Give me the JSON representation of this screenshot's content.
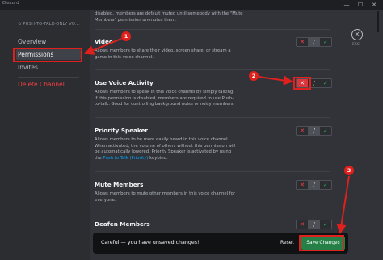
{
  "window": {
    "app_name": "Discord",
    "minimize_glyph": "—",
    "maximize_glyph": "☐",
    "close_glyph": "✕"
  },
  "sidebar": {
    "channel_header": "⟲ PUSH-TO-TALK-ONLY VO...",
    "items": [
      {
        "label": "Overview"
      },
      {
        "label": "Permissions"
      },
      {
        "label": "Invites"
      },
      {
        "label": "Delete Channel"
      }
    ]
  },
  "top_desc": {
    "line1": "disabled, members are default muted until somebody with the \"Mute",
    "line2": "Members\" permission un-mutes them."
  },
  "permissions": [
    {
      "title": "Video",
      "desc": "Allows members to share their video, screen share, or stream a game in this voice channel.",
      "state": "allow_off_neutral"
    },
    {
      "title": "Use Voice Activity",
      "desc": "Allows members to speak in this voice channel by simply talking. If this permission is disabled, members are required to use Push-to-talk. Good for controlling background noise or noisy members.",
      "state": "deny"
    },
    {
      "title": "Priority Speaker",
      "desc_before": "Allows members to be more easily heard in this voice channel. When activated, the volume of others without this permission will be automatically lowered. Priority Speaker is activated by using the ",
      "desc_link": "Push to Talk (Priority)",
      "desc_after": " keybind.",
      "state": "neutral"
    },
    {
      "title": "Mute Members",
      "desc": "Allows members to mute other members in this voice channel for everyone.",
      "state": "neutral"
    },
    {
      "title": "Deafen Members",
      "state": "neutral"
    }
  ],
  "toggle_glyphs": {
    "deny": "✕",
    "neutral": "/",
    "allow": "✓"
  },
  "esc": {
    "glyph": "✕",
    "label": "ESC"
  },
  "savebar": {
    "message": "Careful — you have unsaved changes!",
    "reset_label": "Reset",
    "save_label": "Save Changes"
  },
  "annotations": {
    "step1": "1",
    "step2": "2",
    "step3": "3"
  },
  "colors": {
    "accent_red": "#e0201c",
    "save_green": "#248046",
    "deny_red": "#da373c",
    "allow_green": "#23a55a",
    "link_blue": "#00a8fc"
  }
}
